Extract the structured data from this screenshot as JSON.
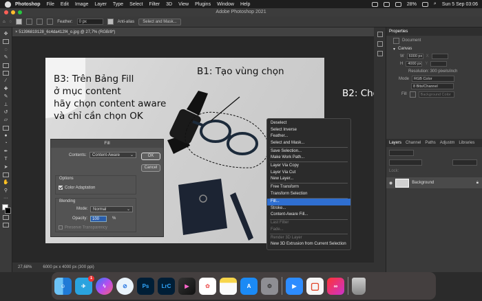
{
  "menubar": {
    "app": "Photoshop",
    "items": [
      "File",
      "Edit",
      "Image",
      "Layer",
      "Type",
      "Select",
      "Filter",
      "3D",
      "View",
      "Plugins",
      "Window",
      "Help"
    ],
    "battery": "28%",
    "datetime": "Sun 5 Sep 03:06"
  },
  "window": {
    "title": "Adobe Photoshop 2021"
  },
  "options": {
    "feather_label": "Feather:",
    "feather_value": "0 px",
    "antialias_label": "Anti-alias",
    "select_mask_label": "Select and Mask..."
  },
  "document": {
    "tab": "51396819128_6c4da412f4_o.jpg @ 27,7% (RGB/8*)",
    "zoom": "27,68%",
    "size_info": "6000 px x 4000 px (300 ppi)"
  },
  "annotations": {
    "b1": "B1: Tạo vùng chọn",
    "b2": "B2: Chọn Fill",
    "b3": [
      "B3: Trên Bảng Fill",
      "ở mục content",
      "hãy chọn content aware",
      "và chỉ cần chọn OK"
    ]
  },
  "context_menu": {
    "groups": [
      [
        "Deselect",
        "Select Inverse",
        "Feather...",
        "Select and Mask..."
      ],
      [
        "Save Selection...",
        "Make Work Path..."
      ],
      [
        "Layer Via Copy",
        "Layer Via Cut",
        "New Layer..."
      ],
      [
        "Free Transform",
        "Transform Selection"
      ],
      [
        "Fill...",
        "Stroke...",
        "Content-Aware Fill..."
      ],
      [
        "Last Filter",
        "Fade..."
      ],
      [
        "Render 3D Layer",
        "New 3D Extrusion from Current Selection"
      ]
    ],
    "highlighted": "Fill...",
    "disabled": [
      "Last Filter",
      "Fade...",
      "Render 3D Layer"
    ]
  },
  "fill_dialog": {
    "title": "Fill",
    "contents_label": "Contents:",
    "contents_value": "Content-Aware",
    "ok": "OK",
    "cancel": "Cancel",
    "options_title": "Options",
    "color_adaptation": "Color Adaptation",
    "blending_title": "Blending",
    "mode_label": "Mode:",
    "mode_value": "Normal",
    "opacity_label": "Opacity:",
    "opacity_value": "100",
    "opacity_unit": "%",
    "preserve_transparency": "Preserve Transparency"
  },
  "properties": {
    "tabs": [
      "Properties"
    ],
    "document_label": "Document",
    "canvas_title": "Canvas",
    "w_label": "W",
    "w_value": "6000 px",
    "h_label": "H",
    "h_value": "4000 px",
    "resolution": "Resolution: 300 pixels/inch",
    "mode_label": "Mode",
    "mode_value": "RGB Color",
    "bits_value": "8 Bits/Channel",
    "fill_label": "Fill",
    "fill_value": "Background Color"
  },
  "layers": {
    "tabs": [
      "Layers",
      "Channel",
      "Paths",
      "Adjustm",
      "Libraries"
    ],
    "lock_label": "Lock:",
    "layer_name": "Background"
  },
  "dock": {
    "apps": [
      "Finder",
      "Telegram",
      "Messenger",
      "Safari",
      "Ps",
      "LrC",
      "Final Cut Pro",
      "Photos",
      "Notes",
      "App Store",
      "System Preferences",
      "Zoom",
      "Microsoft Office",
      "Creative Cloud",
      "Trash"
    ],
    "telegram_badge": "1"
  }
}
